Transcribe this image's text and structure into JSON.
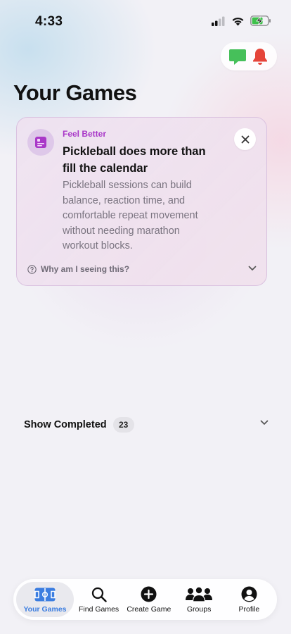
{
  "status_bar": {
    "time": "4:33"
  },
  "header": {
    "title": "Your Games",
    "chat_icon": "chat-bubble-icon",
    "bell_icon": "bell-icon"
  },
  "card": {
    "icon": "note-icon",
    "category": "Feel Better",
    "headline": "Pickleball does more than fill the calendar",
    "body": "Pickleball sessions can build balance, reaction time, and comfortable repeat movement without needing marathon workout blocks.",
    "why_label": "Why am I seeing this?",
    "accent_color": "#a938c8"
  },
  "completed": {
    "label": "Show Completed",
    "count": "23"
  },
  "tabs": [
    {
      "label": "Your Games",
      "icon": "court-icon",
      "active": true
    },
    {
      "label": "Find Games",
      "icon": "search-icon",
      "active": false
    },
    {
      "label": "Create Game",
      "icon": "plus-circle-icon",
      "active": false
    },
    {
      "label": "Groups",
      "icon": "people-icon",
      "active": false
    },
    {
      "label": "Profile",
      "icon": "person-circle-icon",
      "active": false
    }
  ],
  "colors": {
    "active_tab": "#3b7de0",
    "chat_green": "#3fb950",
    "bell_red": "#e5453a"
  }
}
